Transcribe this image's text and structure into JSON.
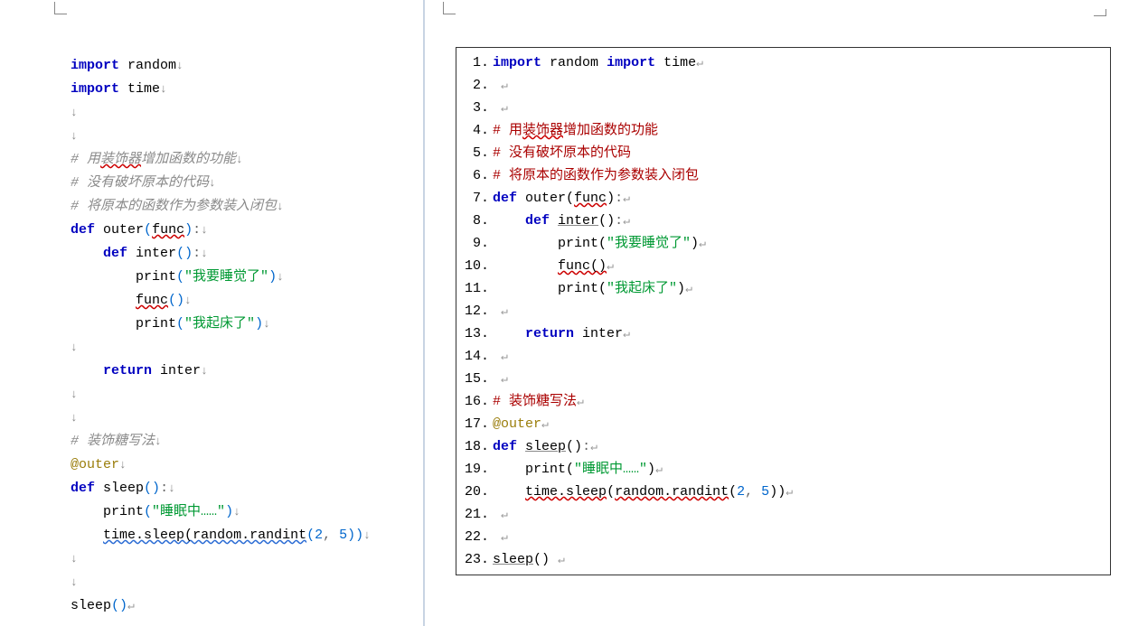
{
  "left": {
    "rulerTab": "",
    "lines": [
      {
        "tokens": [
          [
            "kw",
            "import"
          ],
          [
            "sp",
            " "
          ],
          [
            "id",
            "random"
          ],
          [
            "arrow",
            "↓"
          ]
        ]
      },
      {
        "tokens": [
          [
            "kw",
            "import"
          ],
          [
            "sp",
            " "
          ],
          [
            "id",
            "time"
          ],
          [
            "arrow",
            "↓"
          ]
        ]
      },
      {
        "tokens": [
          [
            "arrow",
            "↓"
          ]
        ]
      },
      {
        "tokens": [
          [
            "arrow",
            "↓"
          ]
        ]
      },
      {
        "tokens": [
          [
            "cmt",
            "# 用"
          ],
          [
            "cmt squig",
            "装饰器"
          ],
          [
            "cmt",
            "增加函数的功能"
          ],
          [
            "arrow",
            "↓"
          ]
        ]
      },
      {
        "tokens": [
          [
            "cmt",
            "# 没有破坏原本的代码"
          ],
          [
            "arrow",
            "↓"
          ]
        ]
      },
      {
        "tokens": [
          [
            "cmt",
            "# 将原本的函数作为参数装入闭包"
          ],
          [
            "arrow",
            "↓"
          ]
        ]
      },
      {
        "tokens": [
          [
            "kw",
            "def"
          ],
          [
            "sp",
            " "
          ],
          [
            "id",
            "outer"
          ],
          [
            "brak",
            "("
          ],
          [
            "id squig",
            "func"
          ],
          [
            "brak",
            ")"
          ],
          [
            "punc",
            ":"
          ],
          [
            "arrow",
            "↓"
          ]
        ]
      },
      {
        "tokens": [
          [
            "sp",
            "    "
          ],
          [
            "kw",
            "def"
          ],
          [
            "sp",
            " "
          ],
          [
            "id",
            "inter"
          ],
          [
            "brak",
            "()"
          ],
          [
            "punc",
            ":"
          ],
          [
            "arrow",
            "↓"
          ]
        ]
      },
      {
        "tokens": [
          [
            "sp",
            "        "
          ],
          [
            "id",
            "print"
          ],
          [
            "brak",
            "("
          ],
          [
            "strL",
            "\"我要睡觉了\""
          ],
          [
            "brak",
            ")"
          ],
          [
            "arrow",
            "↓"
          ]
        ]
      },
      {
        "tokens": [
          [
            "sp",
            "        "
          ],
          [
            "id squig",
            "func"
          ],
          [
            "brak",
            "()"
          ],
          [
            "arrow",
            "↓"
          ]
        ]
      },
      {
        "tokens": [
          [
            "sp",
            "        "
          ],
          [
            "id",
            "print"
          ],
          [
            "brak",
            "("
          ],
          [
            "strL",
            "\"我起床了\""
          ],
          [
            "brak",
            ")"
          ],
          [
            "arrow",
            "↓"
          ]
        ]
      },
      {
        "tokens": [
          [
            "arrow",
            "↓"
          ]
        ]
      },
      {
        "tokens": [
          [
            "sp",
            "    "
          ],
          [
            "kw",
            "return"
          ],
          [
            "sp",
            " "
          ],
          [
            "id",
            "inter"
          ],
          [
            "arrow",
            "↓"
          ]
        ]
      },
      {
        "tokens": [
          [
            "arrow",
            "↓"
          ]
        ]
      },
      {
        "tokens": [
          [
            "arrow",
            "↓"
          ]
        ]
      },
      {
        "tokens": [
          [
            "cmt",
            "# 装饰糖写法"
          ],
          [
            "arrow",
            "↓"
          ]
        ]
      },
      {
        "tokens": [
          [
            "dec",
            "@outer"
          ],
          [
            "arrow",
            "↓"
          ]
        ]
      },
      {
        "tokens": [
          [
            "kw",
            "def"
          ],
          [
            "sp",
            " "
          ],
          [
            "id",
            "sleep"
          ],
          [
            "brak",
            "()"
          ],
          [
            "punc",
            ":"
          ],
          [
            "arrow",
            "↓"
          ]
        ]
      },
      {
        "tokens": [
          [
            "sp",
            "    "
          ],
          [
            "id",
            "print"
          ],
          [
            "brak",
            "("
          ],
          [
            "strL",
            "\"睡眠中……\""
          ],
          [
            "brak",
            ")"
          ],
          [
            "arrow",
            "↓"
          ]
        ]
      },
      {
        "tokens": [
          [
            "sp",
            "    "
          ],
          [
            "id squig-blue",
            "time."
          ],
          [
            "id squig-blue",
            "sleep"
          ],
          [
            "id squig-blue",
            "("
          ],
          [
            "id squig-blue",
            "random."
          ],
          [
            "id squig-blue",
            "randint"
          ],
          [
            "brak",
            "("
          ],
          [
            "num",
            "2"
          ],
          [
            "punc",
            ", "
          ],
          [
            "num",
            "5"
          ],
          [
            "brak",
            "))"
          ],
          [
            "arrow",
            "↓"
          ]
        ]
      },
      {
        "tokens": [
          [
            "arrow",
            "↓"
          ]
        ]
      },
      {
        "tokens": [
          [
            "arrow",
            "↓"
          ]
        ]
      },
      {
        "tokens": [
          [
            "id",
            "sleep"
          ],
          [
            "brak",
            "()"
          ],
          [
            "ret",
            "↵"
          ]
        ]
      }
    ]
  },
  "right": {
    "lines": [
      {
        "n": "1.",
        "tokens": [
          [
            "kw",
            "import"
          ],
          [
            "sp",
            " "
          ],
          [
            "id",
            "random"
          ],
          [
            "sp",
            " "
          ],
          [
            "kw",
            "import"
          ],
          [
            "sp",
            " "
          ],
          [
            "id",
            "time"
          ],
          [
            "ret",
            "↵"
          ]
        ]
      },
      {
        "n": "2.",
        "tokens": [
          [
            "sp",
            " "
          ],
          [
            "ret",
            "↵"
          ]
        ]
      },
      {
        "n": "3.",
        "tokens": [
          [
            "sp",
            " "
          ],
          [
            "ret",
            "↵"
          ]
        ]
      },
      {
        "n": "4.",
        "tokens": [
          [
            "cmtR",
            "# 用"
          ],
          [
            "cmtR squig",
            "装饰器"
          ],
          [
            "cmtR",
            "增加函数的功能"
          ]
        ]
      },
      {
        "n": "5.",
        "tokens": [
          [
            "cmtR",
            "# 没有破坏原本的代码"
          ]
        ]
      },
      {
        "n": "6.",
        "tokens": [
          [
            "cmtR",
            "# 将原本的函数作为参数装入闭包"
          ]
        ]
      },
      {
        "n": "7.",
        "tokens": [
          [
            "kw",
            "def"
          ],
          [
            "sp",
            " "
          ],
          [
            "id",
            "outer("
          ],
          [
            "id squig",
            "func"
          ],
          [
            "id",
            ")"
          ],
          [
            "punc",
            ":"
          ],
          [
            "ret",
            "↵"
          ]
        ]
      },
      {
        "n": "8.",
        "tokens": [
          [
            "sp",
            "    "
          ],
          [
            "kw",
            "def"
          ],
          [
            "sp",
            " "
          ],
          [
            "id ul",
            "inter"
          ],
          [
            "id",
            "()"
          ],
          [
            "punc",
            ":"
          ],
          [
            "ret",
            "↵"
          ]
        ]
      },
      {
        "n": "9.",
        "tokens": [
          [
            "sp",
            "        "
          ],
          [
            "id",
            "print("
          ],
          [
            "str",
            "\"我要睡觉了\""
          ],
          [
            "id",
            ")"
          ],
          [
            "ret",
            "↵"
          ]
        ]
      },
      {
        "n": "10.",
        "tokens": [
          [
            "sp",
            "        "
          ],
          [
            "id squig",
            "func"
          ],
          [
            "id squig",
            "("
          ],
          [
            "id squig",
            ")"
          ],
          [
            "ret",
            "↵"
          ]
        ]
      },
      {
        "n": "11.",
        "tokens": [
          [
            "sp",
            "        "
          ],
          [
            "id",
            "print("
          ],
          [
            "str",
            "\"我起床了\""
          ],
          [
            "id",
            ")"
          ],
          [
            "ret",
            "↵"
          ]
        ]
      },
      {
        "n": "12.",
        "tokens": [
          [
            "sp",
            " "
          ],
          [
            "ret",
            "↵"
          ]
        ]
      },
      {
        "n": "13.",
        "tokens": [
          [
            "sp",
            "    "
          ],
          [
            "kw",
            "return"
          ],
          [
            "sp",
            " "
          ],
          [
            "id",
            "inter"
          ],
          [
            "ret",
            "↵"
          ]
        ]
      },
      {
        "n": "14.",
        "tokens": [
          [
            "sp",
            " "
          ],
          [
            "ret",
            "↵"
          ]
        ]
      },
      {
        "n": "15.",
        "tokens": [
          [
            "sp",
            " "
          ],
          [
            "ret",
            "↵"
          ]
        ]
      },
      {
        "n": "16.",
        "tokens": [
          [
            "cmtR",
            "# 装饰糖写法"
          ],
          [
            "ret",
            "↵"
          ]
        ]
      },
      {
        "n": "17.",
        "tokens": [
          [
            "dec",
            "@outer"
          ],
          [
            "ret",
            "↵"
          ]
        ]
      },
      {
        "n": "18.",
        "tokens": [
          [
            "kw",
            "def"
          ],
          [
            "sp",
            " "
          ],
          [
            "id ul",
            "sleep"
          ],
          [
            "id",
            "()"
          ],
          [
            "punc",
            ":"
          ],
          [
            "ret",
            "↵"
          ]
        ]
      },
      {
        "n": "19.",
        "tokens": [
          [
            "sp",
            "    "
          ],
          [
            "id",
            "print("
          ],
          [
            "str",
            "\"睡眠中……\""
          ],
          [
            "id",
            ")"
          ],
          [
            "ret",
            "↵"
          ]
        ]
      },
      {
        "n": "20.",
        "tokens": [
          [
            "sp",
            "    "
          ],
          [
            "id squig",
            "time"
          ],
          [
            "id squig",
            "."
          ],
          [
            "id squig",
            "sleep"
          ],
          [
            "id",
            "("
          ],
          [
            "id squig",
            "random"
          ],
          [
            "id squig",
            "."
          ],
          [
            "id squig",
            "randint"
          ],
          [
            "id",
            "("
          ],
          [
            "num",
            "2"
          ],
          [
            "punc",
            ", "
          ],
          [
            "num",
            "5"
          ],
          [
            "id",
            "))"
          ],
          [
            "ret",
            "↵"
          ]
        ]
      },
      {
        "n": "21.",
        "tokens": [
          [
            "sp",
            " "
          ],
          [
            "ret",
            "↵"
          ]
        ]
      },
      {
        "n": "22.",
        "tokens": [
          [
            "sp",
            " "
          ],
          [
            "ret",
            "↵"
          ]
        ]
      },
      {
        "n": "23.",
        "tokens": [
          [
            "id ul",
            "sleep"
          ],
          [
            "id",
            "()"
          ],
          [
            "sp",
            " "
          ],
          [
            "ret",
            "↵"
          ]
        ]
      }
    ]
  }
}
